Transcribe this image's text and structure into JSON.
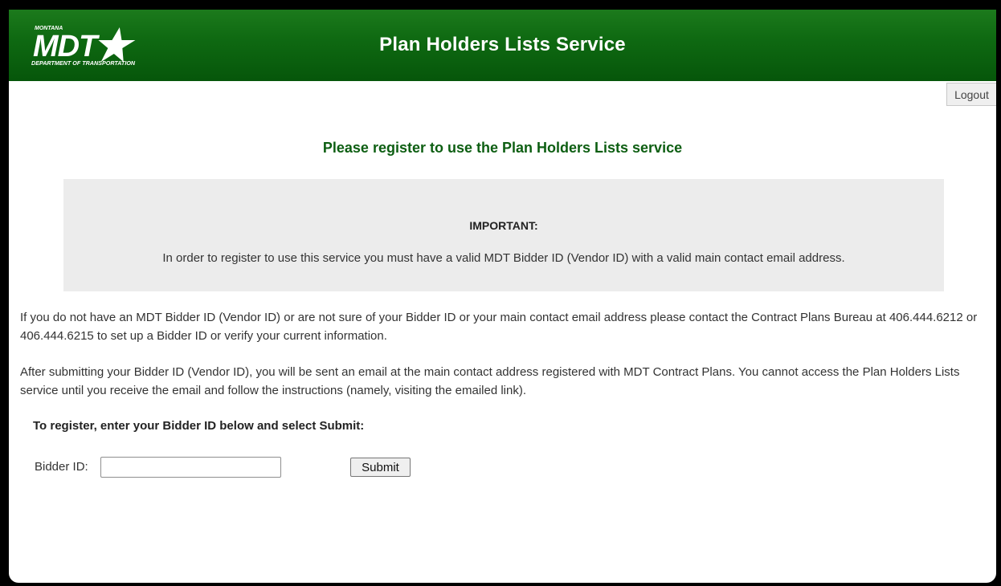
{
  "header": {
    "logo": {
      "top_text": "MONTANA",
      "main_text": "MDT",
      "bottom_text": "DEPARTMENT OF TRANSPORTATION",
      "icon": "star-icon"
    },
    "title": "Plan Holders Lists Service"
  },
  "logout_label": "Logout",
  "page_title": "Please register to use the Plan Holders Lists service",
  "important": {
    "heading": "IMPORTANT:",
    "text": "In order to register to use this service you must have a valid MDT Bidder ID (Vendor ID) with a valid main contact email address."
  },
  "paragraphs": {
    "no_id": "If you do not have an MDT Bidder ID (Vendor ID) or are not sure of your Bidder ID or your main contact email address please contact the Contract Plans Bureau at 406.444.6212 or 406.444.6215 to set up a Bidder ID or verify your current information.",
    "after_submit": "After submitting your Bidder ID (Vendor ID), you will be sent an email at the main contact address registered with MDT Contract Plans. You cannot access the Plan Holders Lists service until you receive the email and follow the instructions (namely, visiting the emailed link)."
  },
  "form": {
    "instruction": "To register, enter your Bidder ID below and select Submit:",
    "bidder_label": "Bidder ID:",
    "bidder_value": "",
    "submit_label": "Submit"
  },
  "colors": {
    "header_green": "#0f6a12",
    "title_green": "#0d5e12",
    "important_bg": "#ececec"
  }
}
